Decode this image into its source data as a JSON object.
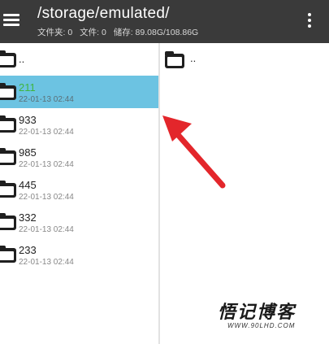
{
  "appbar": {
    "path": "/storage/emulated/",
    "stats": {
      "folders": "文件夹: 0",
      "files": "文件: 0",
      "storage": "储存: 89.08G/108.86G"
    }
  },
  "left_list": [
    {
      "name": "..",
      "date": ""
    },
    {
      "name": "211",
      "date": "22-01-13 02:44"
    },
    {
      "name": "933",
      "date": "22-01-13 02:44"
    },
    {
      "name": "985",
      "date": "22-01-13 02:44"
    },
    {
      "name": "445",
      "date": "22-01-13 02:44"
    },
    {
      "name": "332",
      "date": "22-01-13 02:44"
    },
    {
      "name": "233",
      "date": "22-01-13 02:44"
    }
  ],
  "right_list": [
    {
      "name": ".."
    }
  ],
  "colors": {
    "appbar": "#3a3a3a",
    "selected_row": "#6cc3e2",
    "selected_name": "#3fb53f",
    "arrow": "#e3262b"
  },
  "watermark": {
    "title": "悟记博客",
    "url": "WWW.90LHD.COM"
  }
}
